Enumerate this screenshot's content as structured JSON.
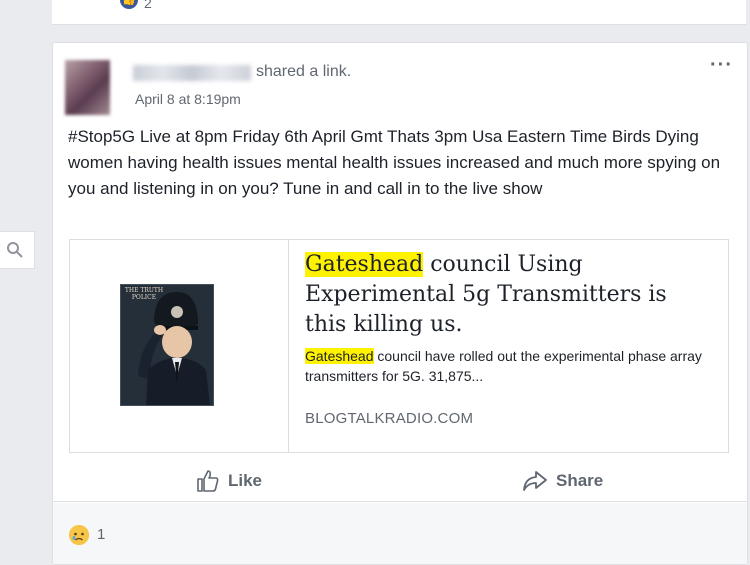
{
  "previous_post": {
    "reaction_count": "2"
  },
  "post": {
    "action_text": "shared a link.",
    "timestamp": "April 8 at 8:19pm",
    "body": "#Stop5G Live at 8pm Friday 6th April Gmt Thats 3pm Usa Eastern Time Birds Dying women having health issues mental health issues increased and much more spying on you and listening in on you? Tune in and call in to the live show",
    "link": {
      "image_caption": "THE TRUTH POLICE",
      "title_highlight": "Gateshead",
      "title_rest": " council Using Experimental 5g Transmitters is this killing us.",
      "desc_highlight": "Gateshead",
      "desc_rest": " council have rolled out the experimental phase array transmitters for 5G. 31,875...",
      "domain": "BLOGTALKRADIO.COM"
    },
    "actions": {
      "like": "Like",
      "share": "Share"
    },
    "reactions": {
      "count": "1",
      "type": "sad"
    }
  },
  "colors": {
    "highlight": "#fff200",
    "brand": "#3b5998"
  }
}
